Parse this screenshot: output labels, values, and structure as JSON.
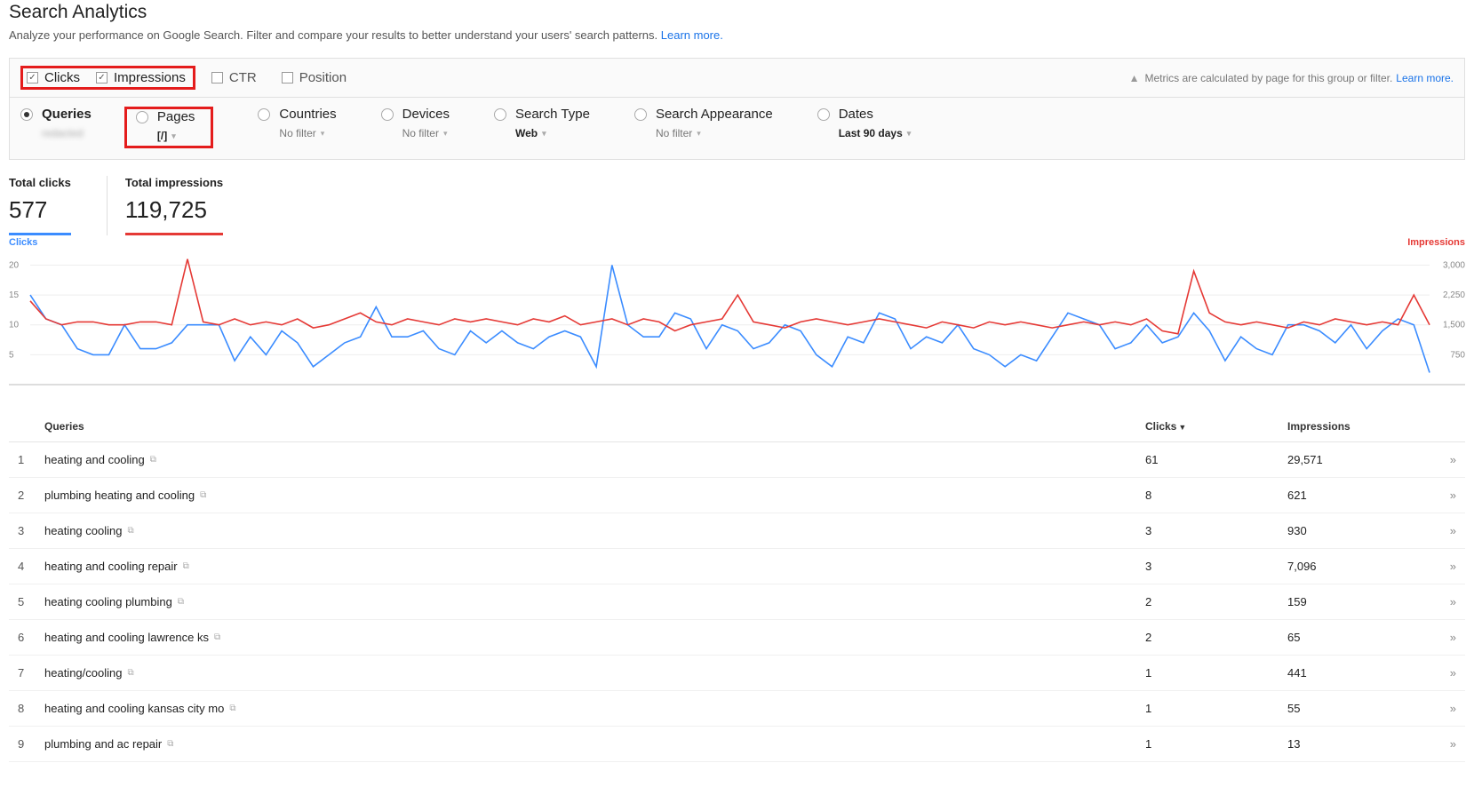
{
  "header": {
    "title": "Search Analytics",
    "subtitle_pre": "Analyze your performance on Google Search. Filter and compare your results to better understand your users' search patterns. ",
    "subtitle_link": "Learn more."
  },
  "metrics": {
    "clicks": "Clicks",
    "impressions": "Impressions",
    "ctr": "CTR",
    "position": "Position",
    "note_text": "Metrics are calculated by page for this group or filter.",
    "note_link": "Learn more."
  },
  "dimensions": {
    "queries": {
      "label": "Queries",
      "sub": "redacted"
    },
    "pages": {
      "label": "Pages",
      "sub": "[/]"
    },
    "countries": {
      "label": "Countries",
      "sub": "No filter"
    },
    "devices": {
      "label": "Devices",
      "sub": "No filter"
    },
    "search_type": {
      "label": "Search Type",
      "sub": "Web"
    },
    "search_appearance": {
      "label": "Search Appearance",
      "sub": "No filter"
    },
    "dates": {
      "label": "Dates",
      "sub": "Last 90 days"
    }
  },
  "totals": {
    "clicks_label": "Total clicks",
    "clicks_value": "577",
    "impressions_label": "Total impressions",
    "impressions_value": "119,725"
  },
  "chart": {
    "left_label": "Clicks",
    "right_label": "Impressions",
    "y_left_ticks": [
      "20",
      "15",
      "10",
      "5"
    ],
    "y_right_ticks": [
      "3,000",
      "2,250",
      "1,500",
      "750"
    ]
  },
  "chart_data": {
    "type": "line",
    "y_left_range": [
      0,
      22
    ],
    "y_right_range": [
      0,
      3300
    ],
    "series": [
      {
        "name": "Clicks",
        "axis": "left",
        "color": "#3b8cff",
        "values": [
          15,
          11,
          10,
          6,
          5,
          5,
          10,
          6,
          6,
          7,
          10,
          10,
          10,
          4,
          8,
          5,
          9,
          7,
          3,
          5,
          7,
          8,
          13,
          8,
          8,
          9,
          6,
          5,
          9,
          7,
          9,
          7,
          6,
          8,
          9,
          8,
          3,
          20,
          10,
          8,
          8,
          12,
          11,
          6,
          10,
          9,
          6,
          7,
          10,
          9,
          5,
          3,
          8,
          7,
          12,
          11,
          6,
          8,
          7,
          10,
          6,
          5,
          3,
          5,
          4,
          8,
          12,
          11,
          10,
          6,
          7,
          10,
          7,
          8,
          12,
          9,
          4,
          8,
          6,
          5,
          10,
          10,
          9,
          7,
          10,
          6,
          9,
          11,
          10,
          2
        ]
      },
      {
        "name": "Impressions",
        "axis": "right",
        "color": "#e53935",
        "values": [
          2100,
          1650,
          1500,
          1575,
          1575,
          1500,
          1500,
          1575,
          1575,
          1500,
          3150,
          1575,
          1500,
          1650,
          1500,
          1575,
          1500,
          1650,
          1425,
          1500,
          1650,
          1800,
          1575,
          1500,
          1650,
          1575,
          1500,
          1650,
          1575,
          1650,
          1575,
          1500,
          1650,
          1575,
          1725,
          1500,
          1575,
          1650,
          1500,
          1650,
          1575,
          1350,
          1500,
          1575,
          1650,
          2250,
          1575,
          1500,
          1425,
          1575,
          1650,
          1575,
          1500,
          1575,
          1650,
          1575,
          1500,
          1425,
          1575,
          1500,
          1425,
          1575,
          1500,
          1575,
          1500,
          1425,
          1500,
          1575,
          1500,
          1575,
          1500,
          1650,
          1350,
          1275,
          2850,
          1800,
          1575,
          1500,
          1575,
          1500,
          1425,
          1575,
          1500,
          1650,
          1575,
          1500,
          1575,
          1500,
          2250,
          1500
        ]
      }
    ]
  },
  "table": {
    "headers": {
      "queries": "Queries",
      "clicks": "Clicks",
      "impressions": "Impressions"
    },
    "rows": [
      {
        "idx": "1",
        "query": "heating and cooling",
        "clicks": "61",
        "impressions": "29,571"
      },
      {
        "idx": "2",
        "query": "plumbing heating and cooling",
        "clicks": "8",
        "impressions": "621"
      },
      {
        "idx": "3",
        "query": "heating cooling",
        "clicks": "3",
        "impressions": "930"
      },
      {
        "idx": "4",
        "query": "heating and cooling repair",
        "clicks": "3",
        "impressions": "7,096"
      },
      {
        "idx": "5",
        "query": "heating cooling plumbing",
        "clicks": "2",
        "impressions": "159"
      },
      {
        "idx": "6",
        "query": "heating and cooling lawrence ks",
        "clicks": "2",
        "impressions": "65"
      },
      {
        "idx": "7",
        "query": "heating/cooling",
        "clicks": "1",
        "impressions": "441"
      },
      {
        "idx": "8",
        "query": "heating and cooling kansas city mo",
        "clicks": "1",
        "impressions": "55"
      },
      {
        "idx": "9",
        "query": "plumbing and ac repair",
        "clicks": "1",
        "impressions": "13"
      }
    ]
  }
}
